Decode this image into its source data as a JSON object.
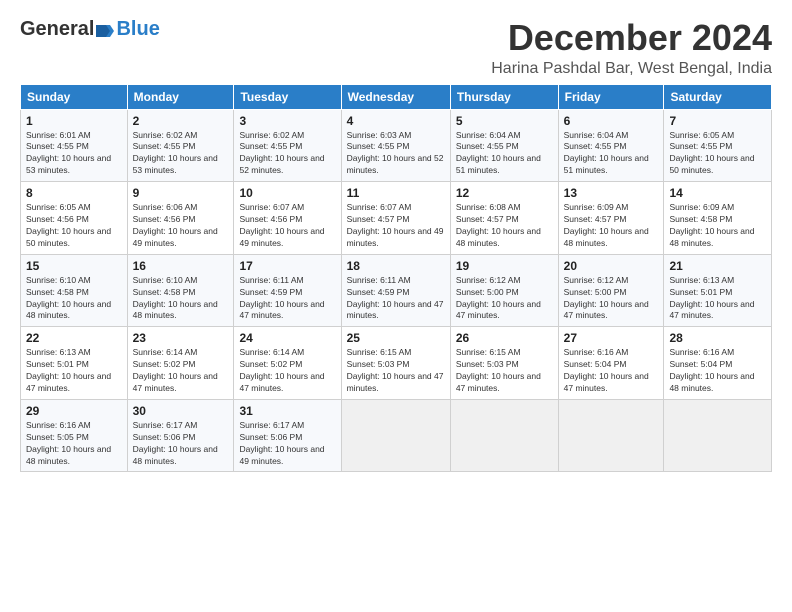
{
  "header": {
    "logo_general": "General",
    "logo_blue": "Blue",
    "main_title": "December 2024",
    "subtitle": "Harina Pashdal Bar, West Bengal, India"
  },
  "days_of_week": [
    "Sunday",
    "Monday",
    "Tuesday",
    "Wednesday",
    "Thursday",
    "Friday",
    "Saturday"
  ],
  "weeks": [
    [
      {
        "day": "1",
        "sunrise": "6:01 AM",
        "sunset": "4:55 PM",
        "daylight": "10 hours and 53 minutes."
      },
      {
        "day": "2",
        "sunrise": "6:02 AM",
        "sunset": "4:55 PM",
        "daylight": "10 hours and 53 minutes."
      },
      {
        "day": "3",
        "sunrise": "6:02 AM",
        "sunset": "4:55 PM",
        "daylight": "10 hours and 52 minutes."
      },
      {
        "day": "4",
        "sunrise": "6:03 AM",
        "sunset": "4:55 PM",
        "daylight": "10 hours and 52 minutes."
      },
      {
        "day": "5",
        "sunrise": "6:04 AM",
        "sunset": "4:55 PM",
        "daylight": "10 hours and 51 minutes."
      },
      {
        "day": "6",
        "sunrise": "6:04 AM",
        "sunset": "4:55 PM",
        "daylight": "10 hours and 51 minutes."
      },
      {
        "day": "7",
        "sunrise": "6:05 AM",
        "sunset": "4:55 PM",
        "daylight": "10 hours and 50 minutes."
      }
    ],
    [
      {
        "day": "8",
        "sunrise": "6:05 AM",
        "sunset": "4:56 PM",
        "daylight": "10 hours and 50 minutes."
      },
      {
        "day": "9",
        "sunrise": "6:06 AM",
        "sunset": "4:56 PM",
        "daylight": "10 hours and 49 minutes."
      },
      {
        "day": "10",
        "sunrise": "6:07 AM",
        "sunset": "4:56 PM",
        "daylight": "10 hours and 49 minutes."
      },
      {
        "day": "11",
        "sunrise": "6:07 AM",
        "sunset": "4:57 PM",
        "daylight": "10 hours and 49 minutes."
      },
      {
        "day": "12",
        "sunrise": "6:08 AM",
        "sunset": "4:57 PM",
        "daylight": "10 hours and 48 minutes."
      },
      {
        "day": "13",
        "sunrise": "6:09 AM",
        "sunset": "4:57 PM",
        "daylight": "10 hours and 48 minutes."
      },
      {
        "day": "14",
        "sunrise": "6:09 AM",
        "sunset": "4:58 PM",
        "daylight": "10 hours and 48 minutes."
      }
    ],
    [
      {
        "day": "15",
        "sunrise": "6:10 AM",
        "sunset": "4:58 PM",
        "daylight": "10 hours and 48 minutes."
      },
      {
        "day": "16",
        "sunrise": "6:10 AM",
        "sunset": "4:58 PM",
        "daylight": "10 hours and 48 minutes."
      },
      {
        "day": "17",
        "sunrise": "6:11 AM",
        "sunset": "4:59 PM",
        "daylight": "10 hours and 47 minutes."
      },
      {
        "day": "18",
        "sunrise": "6:11 AM",
        "sunset": "4:59 PM",
        "daylight": "10 hours and 47 minutes."
      },
      {
        "day": "19",
        "sunrise": "6:12 AM",
        "sunset": "5:00 PM",
        "daylight": "10 hours and 47 minutes."
      },
      {
        "day": "20",
        "sunrise": "6:12 AM",
        "sunset": "5:00 PM",
        "daylight": "10 hours and 47 minutes."
      },
      {
        "day": "21",
        "sunrise": "6:13 AM",
        "sunset": "5:01 PM",
        "daylight": "10 hours and 47 minutes."
      }
    ],
    [
      {
        "day": "22",
        "sunrise": "6:13 AM",
        "sunset": "5:01 PM",
        "daylight": "10 hours and 47 minutes."
      },
      {
        "day": "23",
        "sunrise": "6:14 AM",
        "sunset": "5:02 PM",
        "daylight": "10 hours and 47 minutes."
      },
      {
        "day": "24",
        "sunrise": "6:14 AM",
        "sunset": "5:02 PM",
        "daylight": "10 hours and 47 minutes."
      },
      {
        "day": "25",
        "sunrise": "6:15 AM",
        "sunset": "5:03 PM",
        "daylight": "10 hours and 47 minutes."
      },
      {
        "day": "26",
        "sunrise": "6:15 AM",
        "sunset": "5:03 PM",
        "daylight": "10 hours and 47 minutes."
      },
      {
        "day": "27",
        "sunrise": "6:16 AM",
        "sunset": "5:04 PM",
        "daylight": "10 hours and 47 minutes."
      },
      {
        "day": "28",
        "sunrise": "6:16 AM",
        "sunset": "5:04 PM",
        "daylight": "10 hours and 48 minutes."
      }
    ],
    [
      {
        "day": "29",
        "sunrise": "6:16 AM",
        "sunset": "5:05 PM",
        "daylight": "10 hours and 48 minutes."
      },
      {
        "day": "30",
        "sunrise": "6:17 AM",
        "sunset": "5:06 PM",
        "daylight": "10 hours and 48 minutes."
      },
      {
        "day": "31",
        "sunrise": "6:17 AM",
        "sunset": "5:06 PM",
        "daylight": "10 hours and 49 minutes."
      },
      null,
      null,
      null,
      null
    ]
  ]
}
